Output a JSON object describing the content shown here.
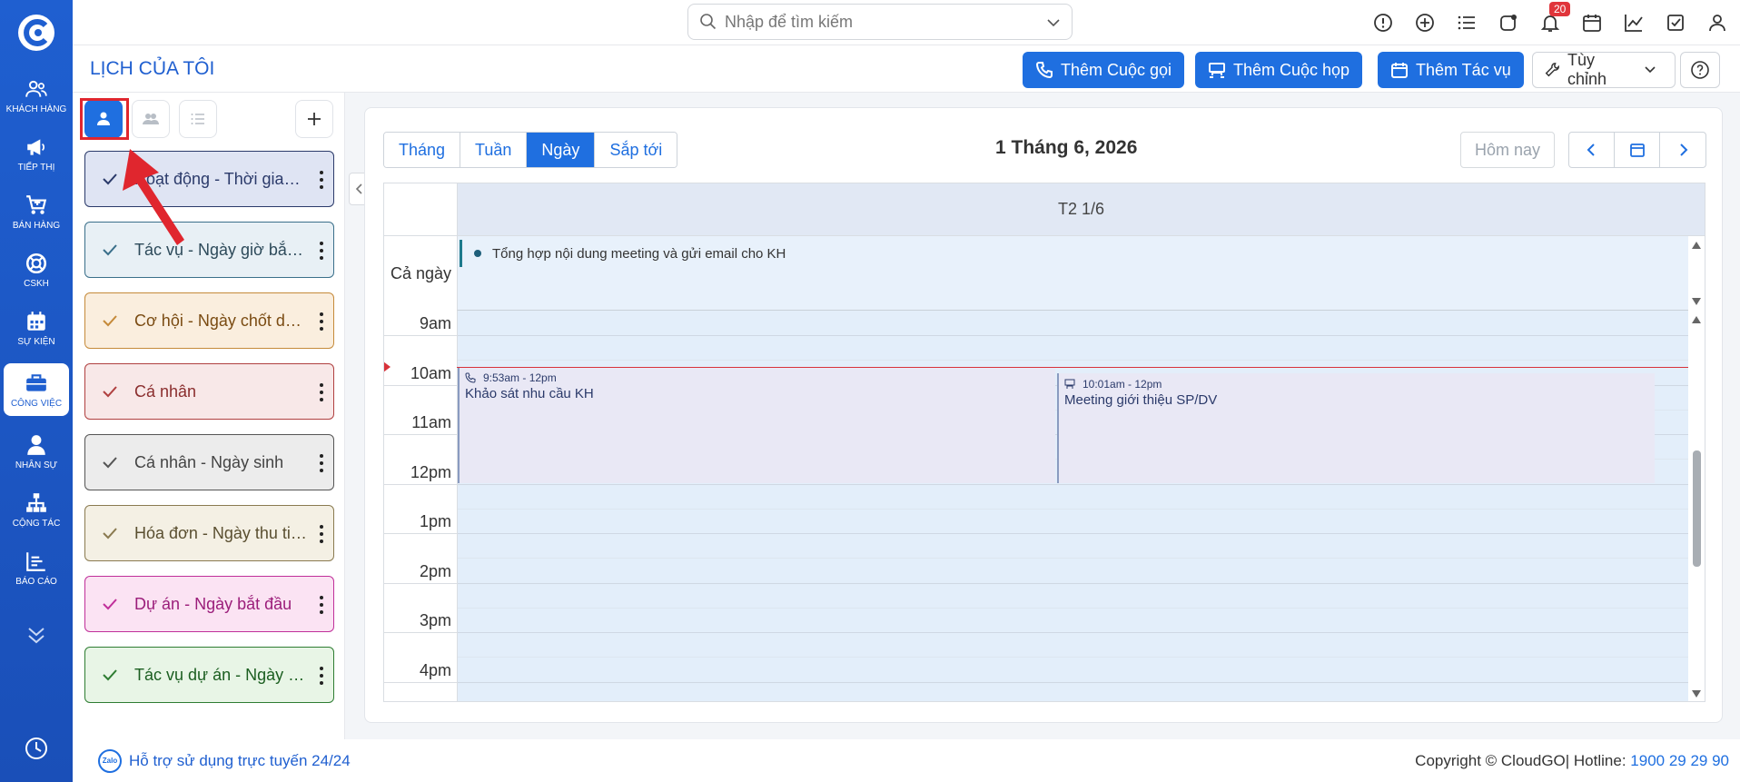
{
  "search": {
    "placeholder": "Nhập để tìm kiếm"
  },
  "notifications": {
    "count": "20"
  },
  "rail": {
    "items": [
      {
        "label": "KHÁCH HÀNG",
        "icon": "users-icon"
      },
      {
        "label": "TIẾP THỊ",
        "icon": "megaphone-icon"
      },
      {
        "label": "BÁN HÀNG",
        "icon": "cart-icon"
      },
      {
        "label": "CSKH",
        "icon": "lifebuoy-icon"
      },
      {
        "label": "SỰ KIỆN",
        "icon": "calendar-icon"
      },
      {
        "label": "CÔNG VIỆC",
        "icon": "briefcase-icon"
      },
      {
        "label": "NHÂN SỰ",
        "icon": "person-icon"
      },
      {
        "label": "CỘNG TÁC",
        "icon": "org-chart-icon"
      },
      {
        "label": "BÁO CÁO",
        "icon": "report-icon"
      }
    ]
  },
  "header": {
    "title": "LỊCH CỦA TÔI",
    "add_call": "Thêm Cuộc gọi",
    "add_meeting": "Thêm Cuộc họp",
    "add_task": "Thêm Tác vụ",
    "customize": "Tùy chỉnh"
  },
  "calendars": [
    {
      "name": "Hoạt động - Thời gian bắt đầu",
      "bg": "#dfe4f3",
      "border": "#2b3a6a",
      "color": "#2b3a6a"
    },
    {
      "name": "Tác vụ - Ngày giờ bắt đầu",
      "bg": "#e8f0f5",
      "border": "#3a6f8a",
      "color": "#2d4a5a"
    },
    {
      "name": "Cơ hội - Ngày chốt dự kiến",
      "bg": "#faeede",
      "border": "#c58a3a",
      "color": "#7a4b12"
    },
    {
      "name": "Cá nhân",
      "bg": "#f8e8e8",
      "border": "#b04040",
      "color": "#8a2d2d"
    },
    {
      "name": "Cá nhân - Ngày sinh",
      "bg": "#ececec",
      "border": "#555555",
      "color": "#444444"
    },
    {
      "name": "Hóa đơn - Ngày thu tiền",
      "bg": "#f4f0e4",
      "border": "#8a7a50",
      "color": "#5a4f30"
    },
    {
      "name": "Dự án - Ngày bắt đầu",
      "bg": "#fbe3f3",
      "border": "#c0309a",
      "color": "#9b1d7a"
    },
    {
      "name": "Tác vụ dự án - Ngày bắt đầu",
      "bg": "#e8f5e6",
      "border": "#2e7d32",
      "color": "#1b5e20"
    }
  ],
  "calendar": {
    "views": [
      "Tháng",
      "Tuần",
      "Ngày",
      "Sắp tới"
    ],
    "active_view": "Ngày",
    "title": "1 Tháng 6, 2026",
    "today": "Hôm nay",
    "day_header": "T2 1/6",
    "allday_label": "Cả ngày",
    "allday_event": "Tổng hợp nội dung meeting và gửi email cho KH",
    "hours": [
      "9am",
      "10am",
      "11am",
      "12pm",
      "1pm",
      "2pm",
      "3pm",
      "4pm"
    ],
    "events": [
      {
        "time": "9:53am - 12pm",
        "title": "Khảo sát nhu cầu KH",
        "icon": "phone-icon"
      },
      {
        "time": "10:01am - 12pm",
        "title": "Meeting giới thiệu SP/DV",
        "icon": "meeting-icon"
      }
    ]
  },
  "footer": {
    "support": "Hỗ trợ sử dụng trực tuyến 24/24",
    "copyright": "Copyright © CloudGO",
    "hotline_label": "| Hotline: ",
    "hotline": "1900 29 29 90"
  },
  "colors": {
    "brand": "#1f5fd0",
    "accent": "#1f6fe0",
    "now_line": "#d8323a"
  }
}
